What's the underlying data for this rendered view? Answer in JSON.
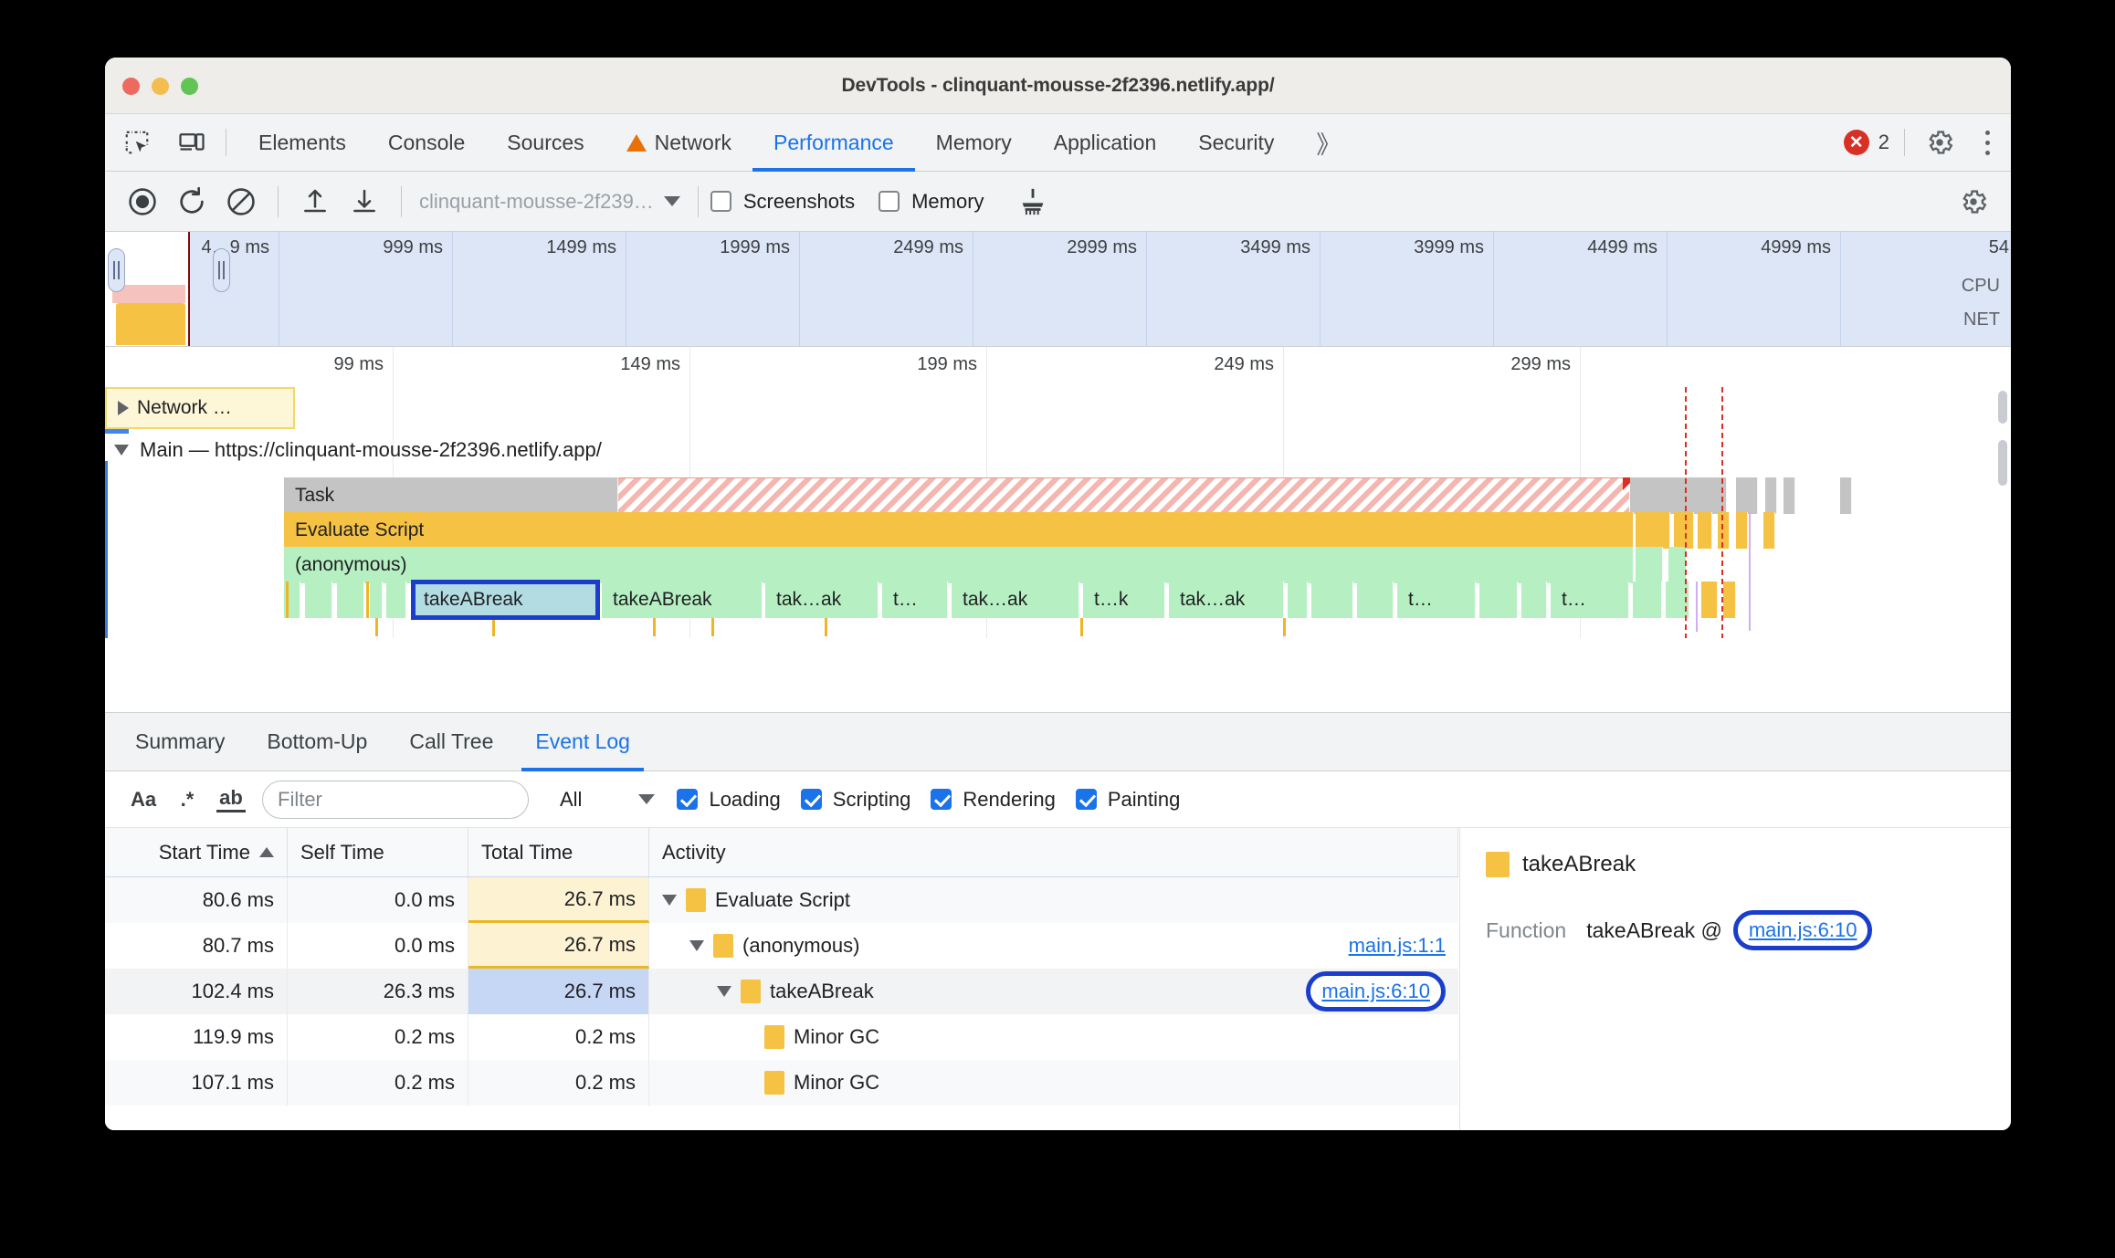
{
  "window": {
    "title": "DevTools - clinquant-mousse-2f2396.netlify.app/"
  },
  "tabbar": {
    "tabs": [
      {
        "label": "Elements",
        "active": false,
        "warning": false
      },
      {
        "label": "Console",
        "active": false,
        "warning": false
      },
      {
        "label": "Sources",
        "active": false,
        "warning": false
      },
      {
        "label": "Network",
        "active": false,
        "warning": true
      },
      {
        "label": "Performance",
        "active": true,
        "warning": false
      },
      {
        "label": "Memory",
        "active": false,
        "warning": false
      },
      {
        "label": "Application",
        "active": false,
        "warning": false
      },
      {
        "label": "Security",
        "active": false,
        "warning": false
      }
    ],
    "more_label": "》",
    "error_count": "2",
    "error_glyph": "✕"
  },
  "perf_toolbar": {
    "url_select_value": "clinquant-mousse-2f239…",
    "screenshots_label": "Screenshots",
    "screenshots_checked": false,
    "memory_label": "Memory",
    "memory_checked": false
  },
  "overview": {
    "ticks": [
      "4…9 ms",
      "999 ms",
      "1499 ms",
      "1999 ms",
      "2499 ms",
      "2999 ms",
      "3499 ms",
      "3999 ms",
      "4499 ms",
      "4999 ms",
      "54"
    ],
    "cpu_label": "CPU",
    "net_label": "NET"
  },
  "flame": {
    "ticks": [
      "99 ms",
      "149 ms",
      "199 ms",
      "249 ms",
      "299 ms"
    ],
    "network_track_label": "Network …",
    "main_track_label": "Main — https://clinquant-mousse-2f2396.netlify.app/",
    "task_label": "Task",
    "evaluate_script_label": "Evaluate Script",
    "anonymous_label": "(anonymous)",
    "leaf_labels": [
      "takeABreak",
      "takeABreak",
      "tak…ak",
      "t…",
      "tak…ak",
      "t…k",
      "tak…ak",
      "t…",
      "t…"
    ],
    "selected_leaf": "takeABreak"
  },
  "drawer": {
    "tabs": [
      {
        "label": "Summary",
        "active": false
      },
      {
        "label": "Bottom-Up",
        "active": false
      },
      {
        "label": "Call Tree",
        "active": false
      },
      {
        "label": "Event Log",
        "active": true
      }
    ],
    "filter": {
      "match_case_label": "Aa",
      "regex_label": ".*",
      "whole_word_label": "ab",
      "input_value": "",
      "input_placeholder": "Filter",
      "duration_value": "All",
      "categories": [
        {
          "label": "Loading",
          "checked": true
        },
        {
          "label": "Scripting",
          "checked": true
        },
        {
          "label": "Rendering",
          "checked": true
        },
        {
          "label": "Painting",
          "checked": true
        }
      ]
    },
    "table": {
      "columns": [
        "Start Time",
        "Self Time",
        "Total Time",
        "Activity"
      ],
      "sorted_column": "Start Time",
      "sort_direction": "asc",
      "rows": [
        {
          "start": "80.6 ms",
          "self": "0.0 ms",
          "total": "26.7 ms",
          "total_highlight": true,
          "indent": 0,
          "expander": "down",
          "activity": "Evaluate Script",
          "link": "",
          "selected": false
        },
        {
          "start": "80.7 ms",
          "self": "0.0 ms",
          "total": "26.7 ms",
          "total_highlight": true,
          "indent": 1,
          "expander": "down",
          "activity": "(anonymous)",
          "link": "main.js:1:1",
          "selected": false
        },
        {
          "start": "102.4 ms",
          "self": "26.3 ms",
          "total": "26.7 ms",
          "total_highlight": false,
          "indent": 2,
          "expander": "down",
          "activity": "takeABreak",
          "link": "main.js:6:10",
          "link_circled": true,
          "selected": true
        },
        {
          "start": "119.9 ms",
          "self": "0.2 ms",
          "total": "0.2 ms",
          "total_highlight": false,
          "indent": 3,
          "expander": "none",
          "activity": "Minor GC",
          "link": "",
          "selected": false
        },
        {
          "start": "107.1 ms",
          "self": "0.2 ms",
          "total": "0.2 ms",
          "total_highlight": false,
          "indent": 3,
          "expander": "none",
          "activity": "Minor GC",
          "link": "",
          "selected": false
        }
      ]
    },
    "details": {
      "title": "takeABreak",
      "function_key": "Function",
      "function_value": "takeABreak @",
      "function_link": "main.js:6:10"
    }
  },
  "colors": {
    "accent": "#1a73e8",
    "scripting_yellow": "#f5c243",
    "function_green": "#b6f0c2",
    "task_gray": "#c4c4c4",
    "long_task_red": "#f4b6ae",
    "error_red": "#d93025",
    "warning_orange": "#e8710a",
    "annotation_blue": "#1a3ecb"
  }
}
